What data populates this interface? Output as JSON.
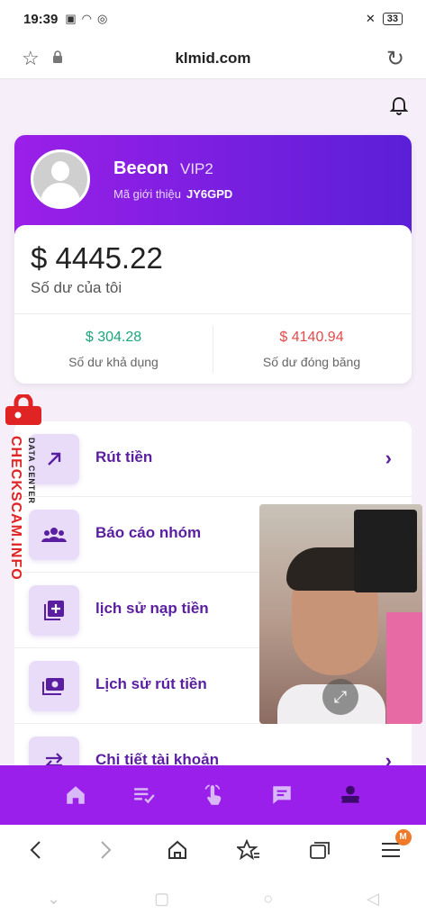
{
  "status": {
    "time": "19:39",
    "battery": "33"
  },
  "browser": {
    "domain": "klmid.com"
  },
  "profile": {
    "name": "Beeon",
    "level": "VIP2",
    "referral_label": "Mã giới thiệu",
    "referral_code": "JY6GPD"
  },
  "balance": {
    "total": "$ 4445.22",
    "total_label": "Số dư của tôi",
    "available": "$ 304.28",
    "available_label": "Số dư khả dụng",
    "frozen": "$ 4140.94",
    "frozen_label": "Số dư đóng băng"
  },
  "menu": [
    {
      "label": "Rút tiền",
      "icon": "arrow-up-right-icon"
    },
    {
      "label": "Báo cáo nhóm",
      "icon": "group-icon"
    },
    {
      "label": "lịch sử nạp tiền",
      "icon": "add-box-icon"
    },
    {
      "label": "Lịch sử rút tiền",
      "icon": "cash-icon"
    },
    {
      "label": "Chi tiết tài khoản",
      "icon": "swap-icon"
    }
  ],
  "watermark": {
    "main": "CHECKSCAM.INFO",
    "small": "DATA CENTER"
  },
  "bottom_nav": [
    "home-icon",
    "tasks-icon",
    "tap-icon",
    "message-icon",
    "user-icon"
  ],
  "browser_toolbar": {
    "badge": "M"
  },
  "colors": {
    "primary": "#9b1fea",
    "accent_text": "#5a1ea0",
    "available": "#1aa77c",
    "frozen": "#e44b4b"
  }
}
